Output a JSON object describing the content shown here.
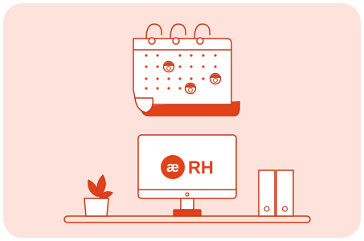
{
  "illustration": {
    "logo_glyph": "æ",
    "logo_text": "RH",
    "colors": {
      "background": "#fde3dc",
      "accent": "#e2411a",
      "line": "#c8391b",
      "paper": "#ffffff"
    },
    "icons": [
      "calendar-icon",
      "computer-monitor-icon",
      "potted-plant-icon",
      "binders-icon",
      "person-avatar-icon"
    ]
  }
}
